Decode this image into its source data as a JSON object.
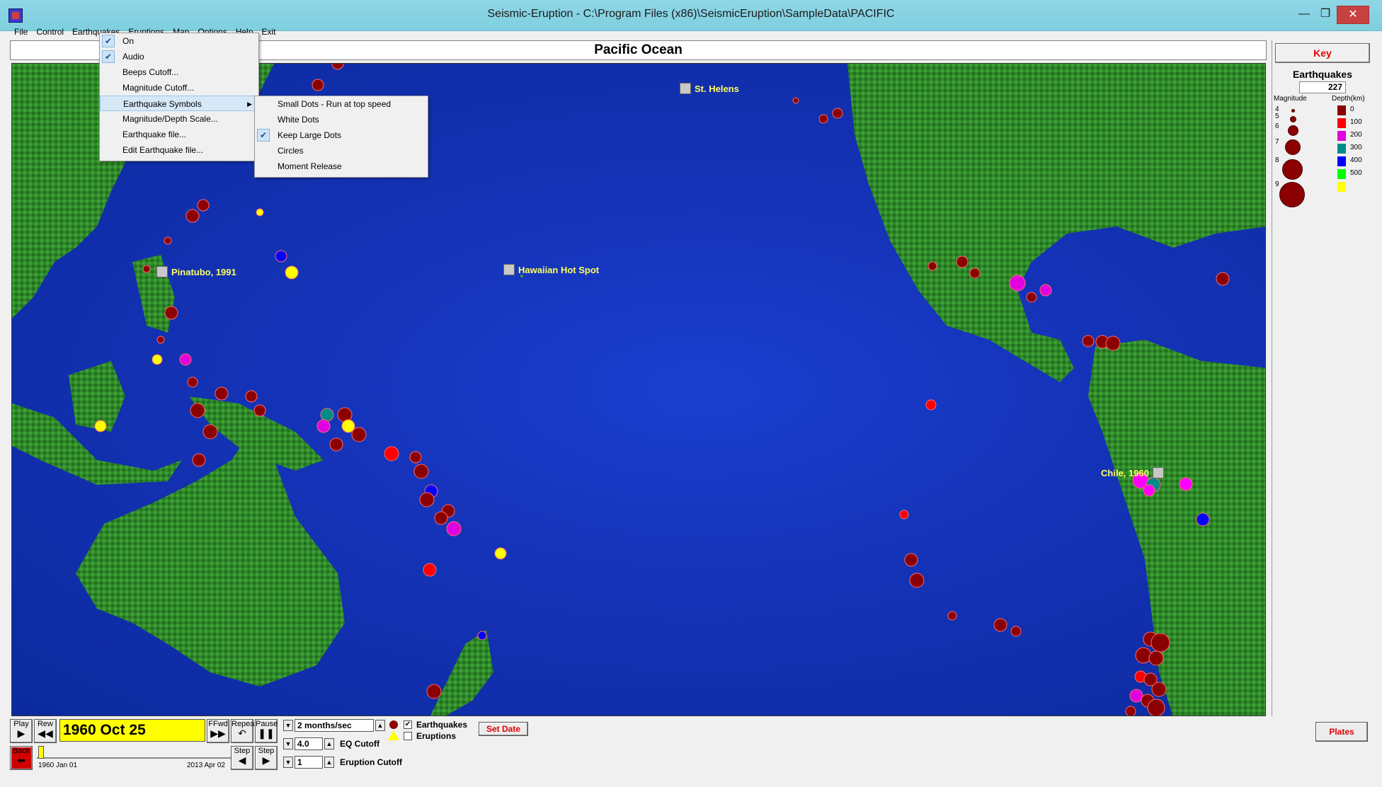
{
  "window": {
    "title": "Seismic-Eruption - C:\\Program Files (x86)\\SeismicEruption\\SampleData\\PACIFIC"
  },
  "menubar": [
    "File",
    "Control",
    "Earthquakes",
    "Eruptions",
    "Map",
    "Options",
    "Help",
    "Exit"
  ],
  "map": {
    "title": "Pacific Ocean",
    "markers": {
      "pinatubo": "Pinatubo, 1991",
      "hawaii": "Hawaiian Hot Spot",
      "st_helens": "St. Helens",
      "chile": "Chile, 1960"
    }
  },
  "earthquakes_menu": {
    "items": [
      "On",
      "Audio",
      "Beeps Cutoff...",
      "Magnitude Cutoff...",
      "Earthquake Symbols",
      "Magnitude/Depth Scale...",
      "Earthquake file...",
      "Edit Earthquake file..."
    ],
    "checked": [
      "On",
      "Audio"
    ],
    "highlighted": "Earthquake Symbols"
  },
  "symbols_submenu": {
    "items": [
      "Small Dots - Run at top speed",
      "White Dots",
      "Keep Large Dots",
      "Circles",
      "Moment Release"
    ],
    "checked": "Keep Large Dots"
  },
  "key": {
    "button": "Key",
    "title": "Earthquakes",
    "count": "227",
    "magnitude_label": "Magnitude",
    "depth_label": "Depth(km)",
    "magnitudes": [
      "4",
      "5",
      "6",
      "7",
      "8",
      "9"
    ],
    "depths": [
      {
        "label": "0",
        "color": "#8b0000"
      },
      {
        "label": "100",
        "color": "#ff0000"
      },
      {
        "label": "200",
        "color": "#e000e0"
      },
      {
        "label": "300",
        "color": "#008b8b"
      },
      {
        "label": "400",
        "color": "#0000ff"
      },
      {
        "label": "500",
        "color": "#00ff00"
      },
      {
        "label": "",
        "color": "#ffff00"
      }
    ]
  },
  "controls": {
    "play": "Play",
    "rew": "Rew",
    "ffwd": "FFwd",
    "repeat": "Repeat",
    "pause": "Pause",
    "back": "Back",
    "step_back": "Step",
    "step_fwd": "Step",
    "current_date": "1960 Oct 25",
    "start_date": "1960 Jan 01",
    "end_date": "2013 Apr 02",
    "speed": "2 months/sec",
    "eq_cutoff_value": "4.0",
    "eq_cutoff_label": "EQ Cutoff",
    "eruption_cutoff_value": "1",
    "eruption_cutoff_label": "Eruption Cutoff",
    "earthquakes_label": "Earthquakes",
    "eruptions_label": "Eruptions",
    "set_date": "Set Date",
    "plates": "Plates"
  }
}
